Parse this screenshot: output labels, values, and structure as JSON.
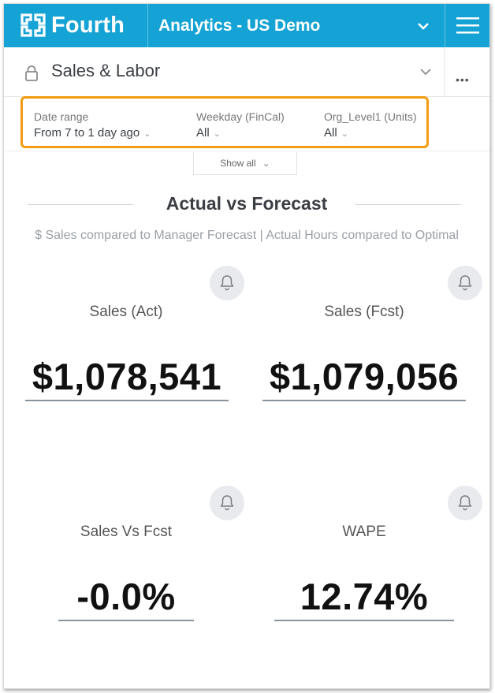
{
  "header": {
    "logo_text": "Fourth",
    "workspace": "Analytics - US Demo",
    "icons": [
      "fourth-logo-icon",
      "chevron-down-icon",
      "hamburger-menu-icon"
    ],
    "brand_color": "#14a3d4"
  },
  "dashboard": {
    "title": "Sales & Labor",
    "more_label": "•••",
    "icons": [
      "lock-icon",
      "chevron-down-icon",
      "more-icon"
    ]
  },
  "filters": {
    "highlight_color": "#f39c12",
    "items": [
      {
        "label": "Date range",
        "value": "From 7 to 1 day ago"
      },
      {
        "label": "Weekday (FinCal)",
        "value": "All"
      },
      {
        "label": "Org_Level1 (Units)",
        "value": "All"
      }
    ],
    "show_all_label": "Show all"
  },
  "section": {
    "title": "Actual vs Forecast",
    "subtitle": "$ Sales compared to Manager Forecast | Actual Hours compared to Optimal"
  },
  "kpis": [
    {
      "label": "Sales (Act)",
      "value": "$1,078,541"
    },
    {
      "label": "Sales (Fcst)",
      "value": "$1,079,056"
    },
    {
      "label": "Sales Vs Fcst",
      "value": "-0.0%"
    },
    {
      "label": "WAPE",
      "value": "12.74%"
    }
  ]
}
